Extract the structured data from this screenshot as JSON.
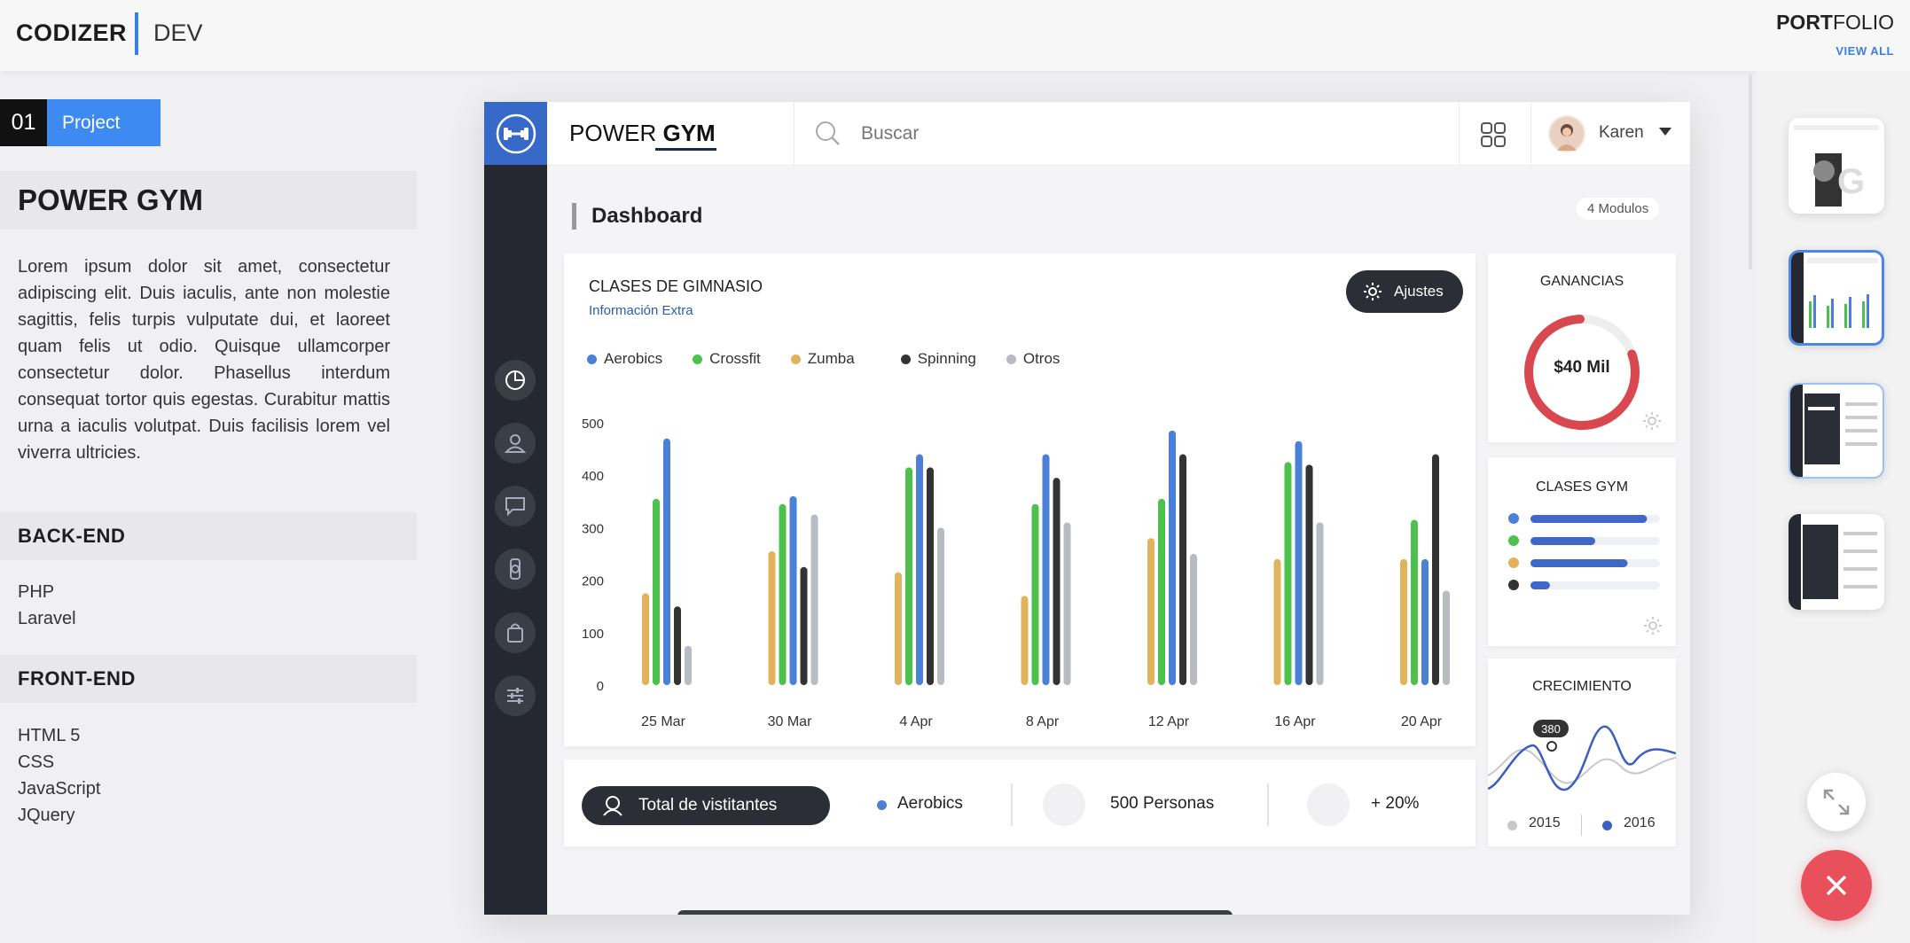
{
  "header": {
    "brand": "CODIZER",
    "brand_sub": "DEV",
    "portfolio_bold": "PORT",
    "portfolio_rest": "FOLIO",
    "view_all": "VIEW ALL"
  },
  "project": {
    "number": "01",
    "tag": "Project",
    "title": "POWER GYM",
    "description": "Lorem ipsum dolor sit amet, consectetur adipiscing elit. Duis iaculis, ante non molestie sagittis, felis turpis vulputate dui, et laoreet quam felis ut odio. Quisque ullamcorper consectetur dolor. Phasellus interdum consequat tortor quis egestas. Curabitur mattis urna a iaculis volutpat. Duis facilisis lorem vel viverra ultricies.",
    "backend_title": "BACK-END",
    "backend": [
      "PHP",
      "Laravel"
    ],
    "frontend_title": "FRONT-END",
    "frontend": [
      "HTML 5",
      "CSS",
      "JavaScript",
      "JQuery"
    ]
  },
  "mockup": {
    "logo_light": "POWER",
    "logo_bold": "GYM",
    "search_placeholder": "Buscar",
    "user": "Karen",
    "page_title": "Dashboard",
    "modules_badge": "4 Modulos",
    "card_title": "CLASES DE GIMNASIO",
    "card_subtitle": "Información Extra",
    "settings_button": "Ajustes",
    "stats": {
      "total_button": "Total de vistitantes",
      "aerobics": "Aerobics",
      "people": "500 Personas",
      "growth": "+ 20%"
    },
    "ganancias": {
      "title": "GANANCIAS",
      "value": "$40 Mil",
      "fraction": 0.8
    },
    "clases_gym": {
      "title": "CLASES GYM",
      "rows": [
        {
          "color": "#4a80d6",
          "value": 0.9
        },
        {
          "color": "#4cc24c",
          "value": 0.5
        },
        {
          "color": "#e0b35c",
          "value": 0.75
        },
        {
          "color": "#333333",
          "value": 0.15
        }
      ]
    },
    "crecimiento": {
      "title": "CRECIMIENTO",
      "badge": "380",
      "year_a": "2015",
      "year_b": "2016"
    }
  },
  "colors": {
    "accent": "#3d8bf2",
    "aerobics": "#4a80d6",
    "crossfit": "#4cc24c",
    "zumba": "#e0b35c",
    "spinning": "#333333",
    "otros": "#b8bbc1",
    "close": "#e8505b"
  },
  "chart_data": {
    "type": "bar",
    "categories": [
      "25 Mar",
      "30 Mar",
      "4 Apr",
      "8 Apr",
      "12 Apr",
      "16 Apr",
      "20 Apr"
    ],
    "ylim": [
      0,
      500
    ],
    "yticks": [
      "500",
      "400",
      "300",
      "200",
      "100",
      "0"
    ],
    "grid": false,
    "legend": "top-left",
    "series": [
      {
        "name": "Aerobics",
        "color": "#4a80d6",
        "values": [
          470,
          360,
          440,
          440,
          485,
          465,
          240
        ]
      },
      {
        "name": "Crossfit",
        "color": "#4cc24c",
        "values": [
          355,
          345,
          415,
          345,
          355,
          425,
          315
        ]
      },
      {
        "name": "Zumba",
        "color": "#e0b35c",
        "values": [
          175,
          255,
          215,
          170,
          280,
          240,
          240
        ]
      },
      {
        "name": "Spinning",
        "color": "#333333",
        "values": [
          150,
          225,
          415,
          395,
          440,
          420,
          440
        ]
      },
      {
        "name": "Otros",
        "color": "#b8bbc1",
        "values": [
          75,
          325,
          300,
          310,
          250,
          310,
          180
        ]
      }
    ]
  }
}
